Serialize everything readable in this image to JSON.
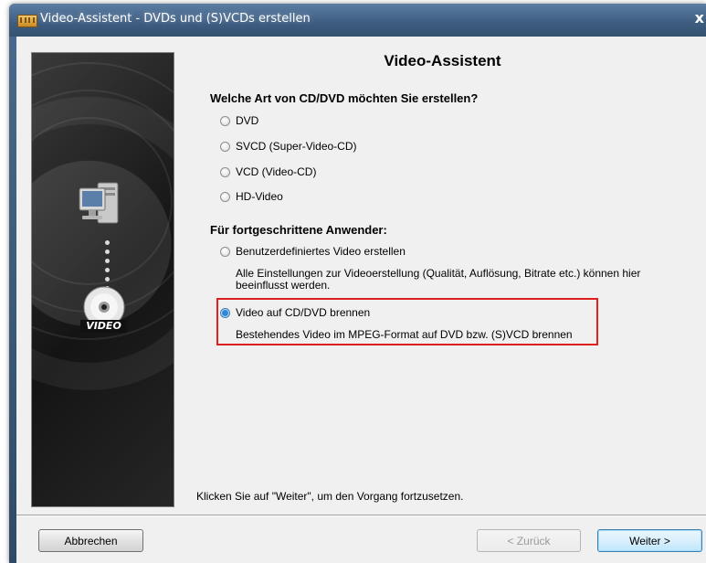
{
  "window": {
    "title": "Video-Assistent - DVDs und (S)VCDs erstellen",
    "close_glyph": "x"
  },
  "sidepanel": {
    "badge_label": "VIDEO"
  },
  "main": {
    "heading": "Video-Assistent",
    "section1_title": "Welche Art von CD/DVD möchten Sie erstellen?",
    "options": [
      {
        "label": "DVD",
        "checked": false
      },
      {
        "label": "SVCD (Super-Video-CD)",
        "checked": false
      },
      {
        "label": "VCD (Video-CD)",
        "checked": false
      },
      {
        "label": "HD-Video",
        "checked": false
      }
    ],
    "section2_title": "Für fortgeschrittene Anwender:",
    "advanced": [
      {
        "label": "Benutzerdefiniertes Video erstellen",
        "checked": false,
        "desc_line1": "Alle Einstellungen zur Videoerstellung (Qualität, Auflösung, Bitrate etc.) können hier",
        "desc_line2": "beeinflusst werden."
      },
      {
        "label": "Video auf CD/DVD brennen",
        "checked": true,
        "desc_line1": "Bestehendes Video im MPEG-Format auf DVD bzw. (S)VCD brennen"
      }
    ],
    "footer_hint": "Klicken Sie auf \"Weiter\", um den Vorgang fortzusetzen."
  },
  "buttons": {
    "cancel": "Abbrechen",
    "back": "< Zurück",
    "next": "Weiter >"
  },
  "colors": {
    "highlight_border": "#e02020",
    "radio_checked": "#2f87d6"
  }
}
